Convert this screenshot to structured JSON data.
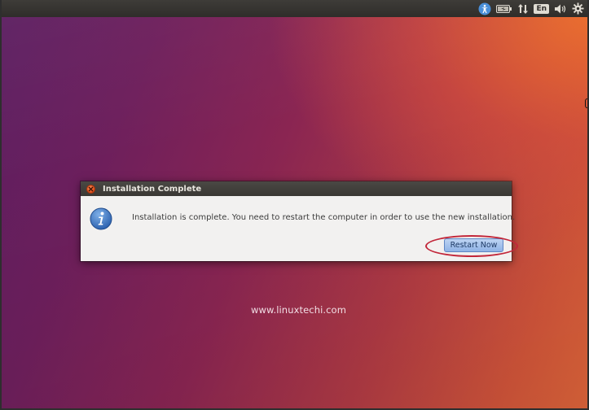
{
  "topbar": {
    "indicators": [
      {
        "name": "accessibility-icon"
      },
      {
        "name": "battery-icon"
      },
      {
        "name": "network-icon"
      },
      {
        "name": "keyboard-layout",
        "label": "En"
      },
      {
        "name": "volume-icon"
      },
      {
        "name": "settings-gear-icon"
      }
    ]
  },
  "dialog": {
    "title": "Installation Complete",
    "icon": "info-icon",
    "message": "Installation is complete. You need to restart the computer in order to use the new installation.",
    "restart_label": "Restart Now"
  },
  "watermark": "www.linuxtechi.com",
  "colors": {
    "accent_highlight": "#c2273a",
    "button_blue": "#8fb3e6",
    "close_orange": "#df4b16",
    "topbar": "#2f2d2a"
  }
}
